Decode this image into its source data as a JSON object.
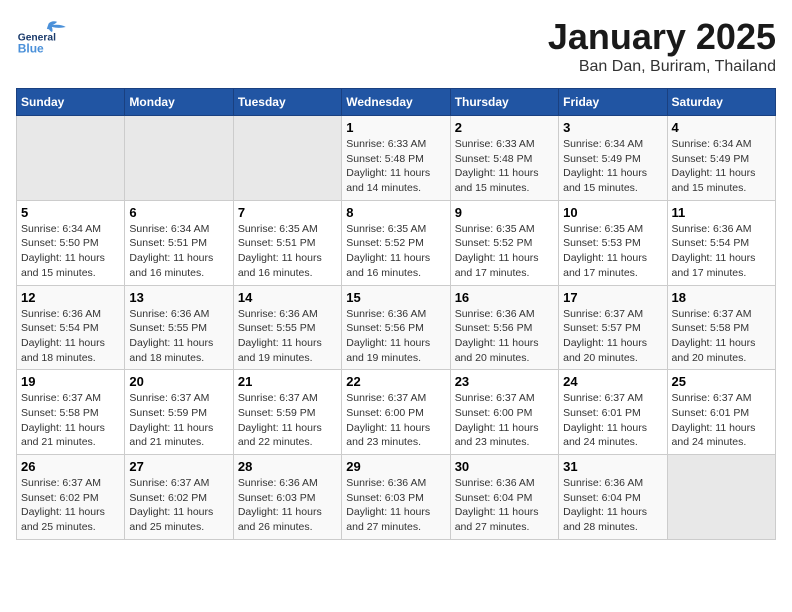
{
  "header": {
    "logo_general": "General",
    "logo_blue": "Blue",
    "month": "January 2025",
    "location": "Ban Dan, Buriram, Thailand"
  },
  "days_of_week": [
    "Sunday",
    "Monday",
    "Tuesday",
    "Wednesday",
    "Thursday",
    "Friday",
    "Saturday"
  ],
  "weeks": [
    [
      {
        "day": "",
        "info": ""
      },
      {
        "day": "",
        "info": ""
      },
      {
        "day": "",
        "info": ""
      },
      {
        "day": "1",
        "info": "Sunrise: 6:33 AM\nSunset: 5:48 PM\nDaylight: 11 hours and 14 minutes."
      },
      {
        "day": "2",
        "info": "Sunrise: 6:33 AM\nSunset: 5:48 PM\nDaylight: 11 hours and 15 minutes."
      },
      {
        "day": "3",
        "info": "Sunrise: 6:34 AM\nSunset: 5:49 PM\nDaylight: 11 hours and 15 minutes."
      },
      {
        "day": "4",
        "info": "Sunrise: 6:34 AM\nSunset: 5:49 PM\nDaylight: 11 hours and 15 minutes."
      }
    ],
    [
      {
        "day": "5",
        "info": "Sunrise: 6:34 AM\nSunset: 5:50 PM\nDaylight: 11 hours and 15 minutes."
      },
      {
        "day": "6",
        "info": "Sunrise: 6:34 AM\nSunset: 5:51 PM\nDaylight: 11 hours and 16 minutes."
      },
      {
        "day": "7",
        "info": "Sunrise: 6:35 AM\nSunset: 5:51 PM\nDaylight: 11 hours and 16 minutes."
      },
      {
        "day": "8",
        "info": "Sunrise: 6:35 AM\nSunset: 5:52 PM\nDaylight: 11 hours and 16 minutes."
      },
      {
        "day": "9",
        "info": "Sunrise: 6:35 AM\nSunset: 5:52 PM\nDaylight: 11 hours and 17 minutes."
      },
      {
        "day": "10",
        "info": "Sunrise: 6:35 AM\nSunset: 5:53 PM\nDaylight: 11 hours and 17 minutes."
      },
      {
        "day": "11",
        "info": "Sunrise: 6:36 AM\nSunset: 5:54 PM\nDaylight: 11 hours and 17 minutes."
      }
    ],
    [
      {
        "day": "12",
        "info": "Sunrise: 6:36 AM\nSunset: 5:54 PM\nDaylight: 11 hours and 18 minutes."
      },
      {
        "day": "13",
        "info": "Sunrise: 6:36 AM\nSunset: 5:55 PM\nDaylight: 11 hours and 18 minutes."
      },
      {
        "day": "14",
        "info": "Sunrise: 6:36 AM\nSunset: 5:55 PM\nDaylight: 11 hours and 19 minutes."
      },
      {
        "day": "15",
        "info": "Sunrise: 6:36 AM\nSunset: 5:56 PM\nDaylight: 11 hours and 19 minutes."
      },
      {
        "day": "16",
        "info": "Sunrise: 6:36 AM\nSunset: 5:56 PM\nDaylight: 11 hours and 20 minutes."
      },
      {
        "day": "17",
        "info": "Sunrise: 6:37 AM\nSunset: 5:57 PM\nDaylight: 11 hours and 20 minutes."
      },
      {
        "day": "18",
        "info": "Sunrise: 6:37 AM\nSunset: 5:58 PM\nDaylight: 11 hours and 20 minutes."
      }
    ],
    [
      {
        "day": "19",
        "info": "Sunrise: 6:37 AM\nSunset: 5:58 PM\nDaylight: 11 hours and 21 minutes."
      },
      {
        "day": "20",
        "info": "Sunrise: 6:37 AM\nSunset: 5:59 PM\nDaylight: 11 hours and 21 minutes."
      },
      {
        "day": "21",
        "info": "Sunrise: 6:37 AM\nSunset: 5:59 PM\nDaylight: 11 hours and 22 minutes."
      },
      {
        "day": "22",
        "info": "Sunrise: 6:37 AM\nSunset: 6:00 PM\nDaylight: 11 hours and 23 minutes."
      },
      {
        "day": "23",
        "info": "Sunrise: 6:37 AM\nSunset: 6:00 PM\nDaylight: 11 hours and 23 minutes."
      },
      {
        "day": "24",
        "info": "Sunrise: 6:37 AM\nSunset: 6:01 PM\nDaylight: 11 hours and 24 minutes."
      },
      {
        "day": "25",
        "info": "Sunrise: 6:37 AM\nSunset: 6:01 PM\nDaylight: 11 hours and 24 minutes."
      }
    ],
    [
      {
        "day": "26",
        "info": "Sunrise: 6:37 AM\nSunset: 6:02 PM\nDaylight: 11 hours and 25 minutes."
      },
      {
        "day": "27",
        "info": "Sunrise: 6:37 AM\nSunset: 6:02 PM\nDaylight: 11 hours and 25 minutes."
      },
      {
        "day": "28",
        "info": "Sunrise: 6:36 AM\nSunset: 6:03 PM\nDaylight: 11 hours and 26 minutes."
      },
      {
        "day": "29",
        "info": "Sunrise: 6:36 AM\nSunset: 6:03 PM\nDaylight: 11 hours and 27 minutes."
      },
      {
        "day": "30",
        "info": "Sunrise: 6:36 AM\nSunset: 6:04 PM\nDaylight: 11 hours and 27 minutes."
      },
      {
        "day": "31",
        "info": "Sunrise: 6:36 AM\nSunset: 6:04 PM\nDaylight: 11 hours and 28 minutes."
      },
      {
        "day": "",
        "info": ""
      }
    ]
  ]
}
